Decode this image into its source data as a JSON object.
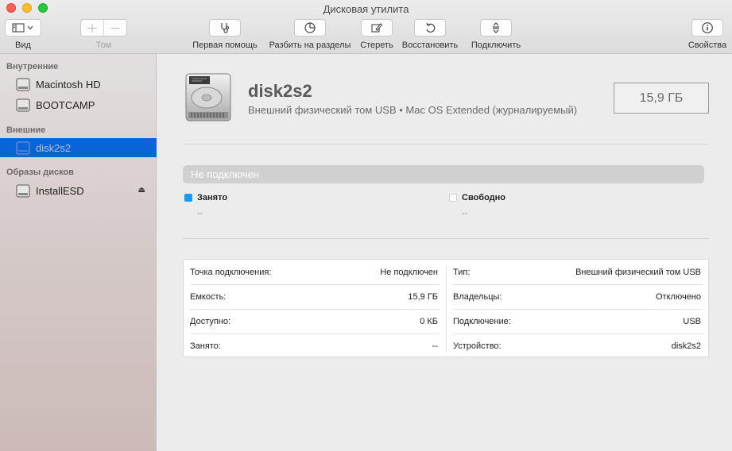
{
  "window": {
    "title": "Дисковая утилита"
  },
  "toolbar": {
    "view_label": "Вид",
    "volume_label": "Том",
    "first_aid_label": "Первая помощь",
    "partition_label": "Разбить на разделы",
    "erase_label": "Стереть",
    "restore_label": "Восстановить",
    "mount_label": "Подключить",
    "info_label": "Свойства"
  },
  "sidebar": {
    "internal_header": "Внутренние",
    "external_header": "Внешние",
    "images_header": "Образы дисков",
    "internal": [
      {
        "label": "Macintosh HD",
        "icon": "internal-disk-icon"
      },
      {
        "label": "BOOTCAMP",
        "icon": "internal-disk-icon"
      }
    ],
    "external": [
      {
        "label": "disk2s2",
        "icon": "external-disk-icon",
        "selected": true
      }
    ],
    "images": [
      {
        "label": "InstallESD",
        "icon": "disk-image-icon",
        "eject": "eject-icon"
      }
    ]
  },
  "volume": {
    "name": "disk2s2",
    "description": "Внешний физический том USB • Mac OS Extended (журналируемый)",
    "size": "15,9 ГБ",
    "status": "Не подключен"
  },
  "usage": {
    "used_label": "Занято",
    "used_value": "--",
    "used_color": "#1a9af0",
    "free_label": "Свободно",
    "free_value": "--",
    "free_color": "#ffffff"
  },
  "info": {
    "left": [
      {
        "key": "Точка подключения:",
        "value": "Не подключен"
      },
      {
        "key": "Емкость:",
        "value": "15,9 ГБ"
      },
      {
        "key": "Доступно:",
        "value": "0 КБ"
      },
      {
        "key": "Занято:",
        "value": "--"
      }
    ],
    "right": [
      {
        "key": "Тип:",
        "value": "Внешний физический том USB"
      },
      {
        "key": "Владельцы:",
        "value": "Отключено"
      },
      {
        "key": "Подключение:",
        "value": "USB"
      },
      {
        "key": "Устройство:",
        "value": "disk2s2"
      }
    ]
  },
  "colors": {
    "selection": "#0a64d8",
    "accent_blue": "#1a9af0"
  }
}
